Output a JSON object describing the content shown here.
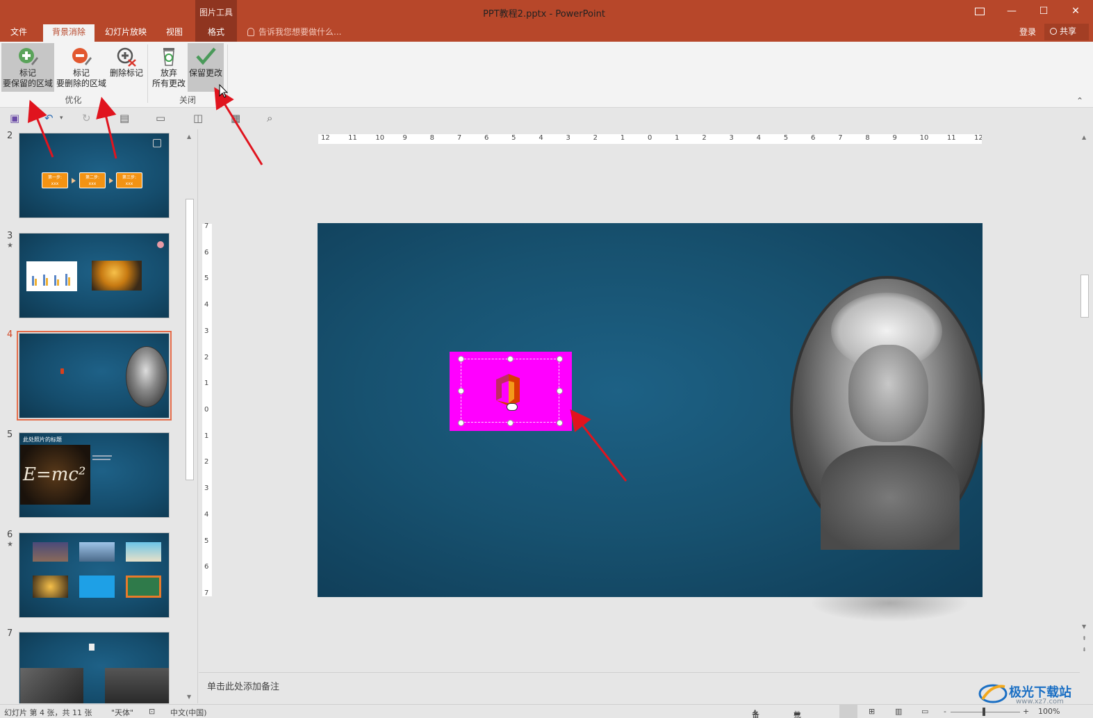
{
  "window": {
    "title": "PPT教程2.pptx - PowerPoint",
    "context_group": "图片工具",
    "restore_icon": "ribbon-display-options-icon",
    "minimize": "—",
    "maximize": "☐",
    "close": "✕"
  },
  "tabs": [
    {
      "label": "文件"
    },
    {
      "label": "背景消除"
    },
    {
      "label": "幻灯片放映"
    },
    {
      "label": "视图"
    },
    {
      "label": "格式"
    }
  ],
  "tell_me": "告诉我您想要做什么...",
  "account": {
    "login": "登录",
    "share": "共享"
  },
  "ribbon": {
    "mark_keep": {
      "line1": "标记",
      "line2": "要保留的区域"
    },
    "mark_remove": {
      "line1": "标记",
      "line2": "要删除的区域"
    },
    "delete_mark": {
      "line1": "删除标记"
    },
    "discard": {
      "line1": "放弃",
      "line2": "所有更改"
    },
    "keep": {
      "line1": "保留更改"
    },
    "group_refine": "优化",
    "group_close": "关闭"
  },
  "thumbnails": [
    {
      "number": "2",
      "star": ""
    },
    {
      "number": "3",
      "star": "★"
    },
    {
      "number": "4",
      "star": ""
    },
    {
      "number": "5",
      "star": ""
    },
    {
      "number": "6",
      "star": "★"
    },
    {
      "number": "7",
      "star": ""
    }
  ],
  "slide2_steps": [
    {
      "label": "第一步:",
      "sub": "xxx"
    },
    {
      "label": "第二步:",
      "sub": "xxx"
    },
    {
      "label": "第三步:",
      "sub": "xxx"
    }
  ],
  "slide5": {
    "title": "此处照片的标题",
    "formula": "E=mc²"
  },
  "notes_placeholder": "单击此处添加备注",
  "status": {
    "slide_info": "幻灯片 第 4 张，共 11 张",
    "theme": "\"天体\"",
    "language": "中文(中国)",
    "notes_btn": "备注",
    "comments_btn": "批注",
    "zoom": "100%",
    "zoom_minus": "-",
    "zoom_plus": "+"
  },
  "watermark": {
    "text": "极光下载站",
    "sub": "www.xz7.com"
  },
  "ruler": {
    "horizontal": [
      "12",
      "11",
      "10",
      "9",
      "8",
      "7",
      "6",
      "5",
      "4",
      "3",
      "2",
      "1",
      "0",
      "1",
      "2",
      "3",
      "4",
      "5",
      "6",
      "7",
      "8",
      "9",
      "10",
      "11",
      "12"
    ],
    "vertical": [
      "7",
      "6",
      "5",
      "4",
      "3",
      "2",
      "1",
      "0",
      "1",
      "2",
      "3",
      "4",
      "5",
      "6",
      "7"
    ]
  },
  "colors": {
    "accent": "#b7472a",
    "pink_bg": "#ff00ff",
    "slide_bg": "#17516f"
  }
}
